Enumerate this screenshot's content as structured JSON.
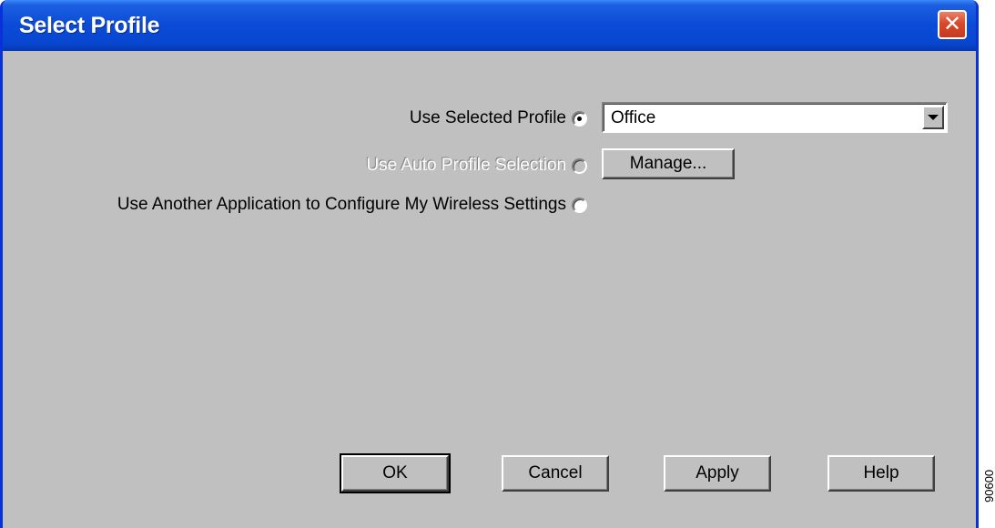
{
  "window": {
    "title": "Select Profile"
  },
  "options": {
    "use_selected_profile": {
      "label": "Use Selected Profile",
      "selected": true
    },
    "use_auto_profile_selection": {
      "label": "Use Auto Profile Selection",
      "selected": false,
      "disabled": true
    },
    "use_another_application": {
      "label": "Use Another Application to Configure My Wireless Settings",
      "selected": false
    }
  },
  "profile_select": {
    "value": "Office"
  },
  "buttons": {
    "manage": "Manage...",
    "ok": "OK",
    "cancel": "Cancel",
    "apply": "Apply",
    "help": "Help"
  },
  "figure_number": "90600",
  "colors": {
    "titlebar": "#0a4bd6",
    "dialog_bg": "#c0c0c0",
    "close_button": "#d8492c"
  }
}
